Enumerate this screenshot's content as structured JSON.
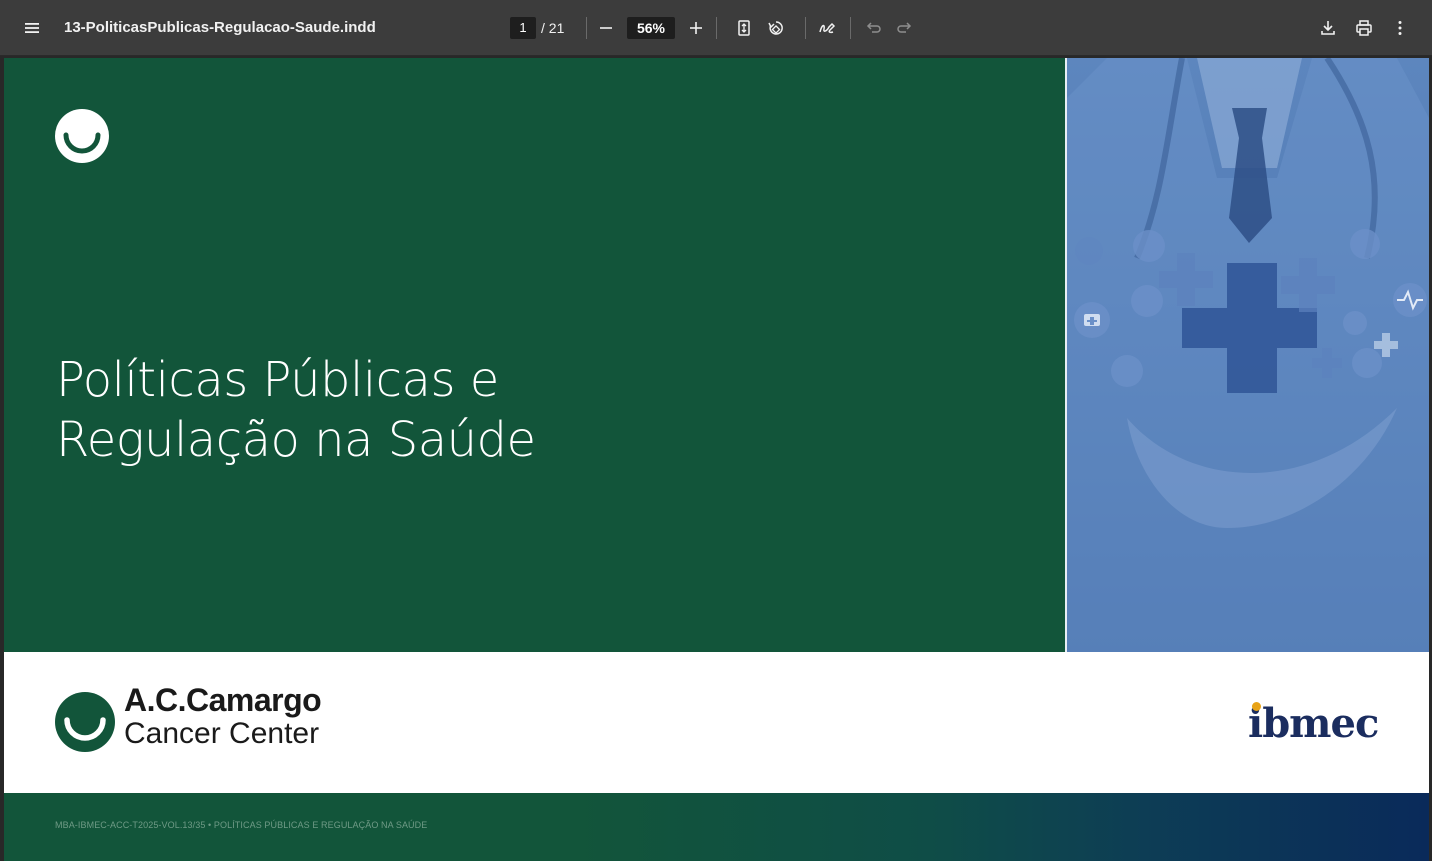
{
  "toolbar": {
    "menu_icon": "hamburger-menu-icon",
    "document_title": "13-PoliticasPublicas-Regulacao-Saude.indd",
    "current_page": "1",
    "page_total": "/ 21",
    "zoom": "56%",
    "icons": [
      "zoom-out-icon",
      "zoom-in-icon",
      "fit-page-icon",
      "rotate-icon",
      "annotate-icon",
      "undo-icon",
      "redo-icon",
      "download-icon",
      "print-icon",
      "more-options-icon"
    ]
  },
  "document": {
    "title_line1": "Políticas Públicas e",
    "title_line2": "Regulação na Saúde",
    "brand_line1": "A.C.Camargo",
    "brand_line2": "Cancer Center",
    "partner_logo": "ibmec",
    "footer": "MBA-IBMEC-ACC-T2025-VOL.13/35 • POLÍTICAS PÚBLICAS E REGULAÇÃO NA SAÚDE",
    "colors": {
      "cover_green": "#12553a",
      "photo_blue": "#4e78b2",
      "ibmec_navy": "#1b2d5f",
      "ibmec_dot": "#e8a317"
    }
  }
}
